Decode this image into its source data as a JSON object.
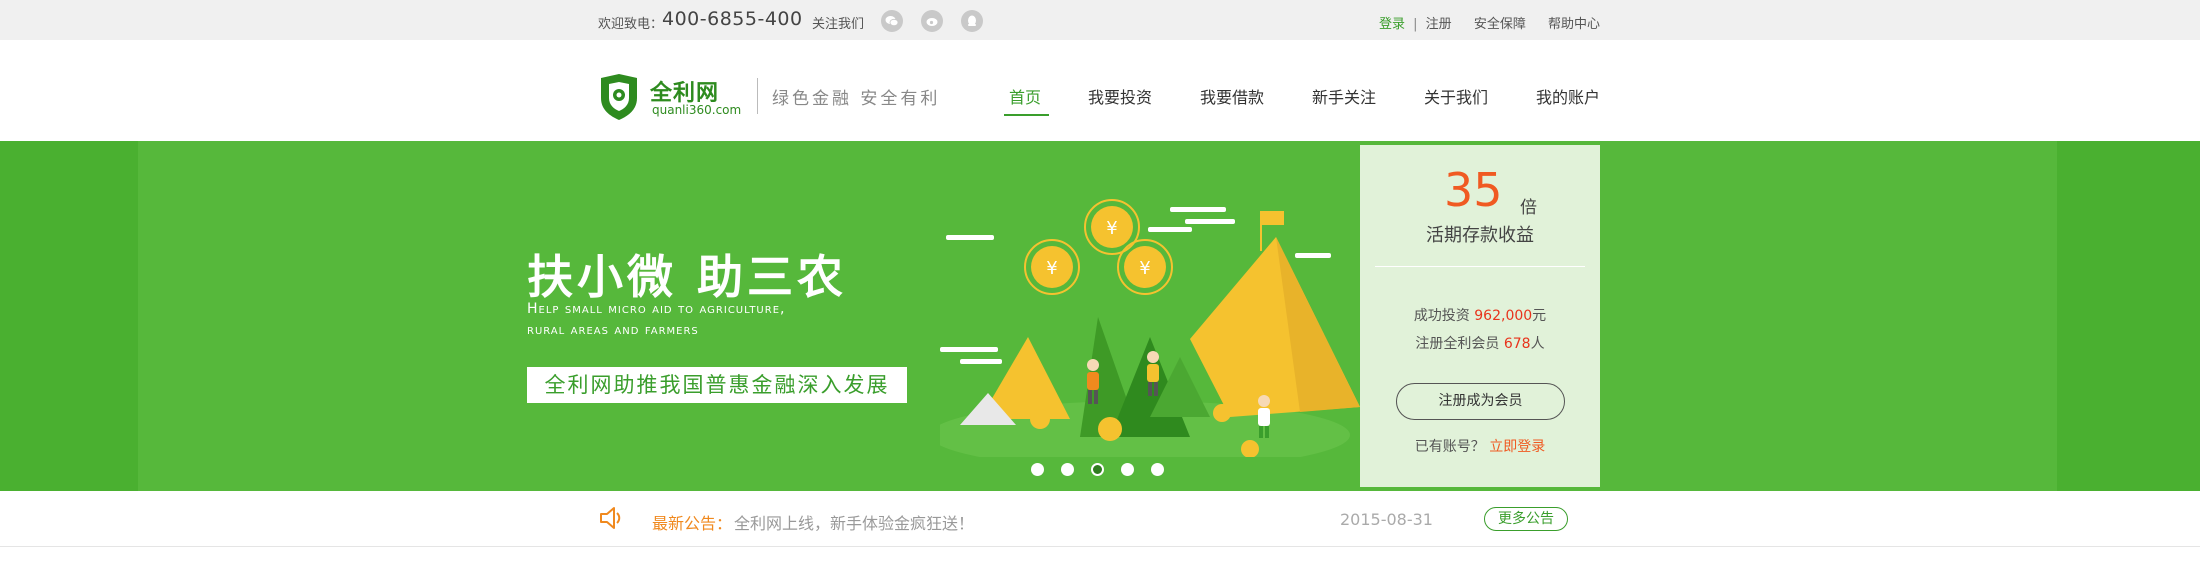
{
  "topbar": {
    "welcome": "欢迎致电：",
    "phone": "400-6855-400",
    "follow": "关注我们",
    "social_icons": [
      "wechat-icon",
      "weibo-icon",
      "qq-icon"
    ],
    "login": "登录",
    "separator": "|",
    "register": "注册",
    "security": "安全保障",
    "help": "帮助中心"
  },
  "header": {
    "logo_cn": "全利网",
    "logo_en": "quanli360.com",
    "slogan": "绿色金融 安全有利",
    "nav": [
      "首页",
      "我要投资",
      "我要借款",
      "新手关注",
      "关于我们",
      "我的账户"
    ],
    "active_nav": "首页"
  },
  "banner": {
    "title": "扶小微  助三农",
    "subtitle_line1": "Help small micro aid to agriculture,",
    "subtitle_line2": "rural areas and farmers",
    "tagline": "全利网助推我国普惠金融深入发展",
    "coin_symbol": "¥",
    "slide_count": 5,
    "active_slide": 3
  },
  "panel": {
    "rate_number": "35",
    "rate_unit": "倍",
    "rate_label": "活期存款收益",
    "invest_label": "成功投资 ",
    "invest_value": "962,000",
    "invest_unit": "元",
    "members_label": "注册全利会员 ",
    "members_value": "678",
    "members_unit": "人",
    "register_button": "注册成为会员",
    "has_account": "已有账号？ ",
    "login_now": "立即登录"
  },
  "notice": {
    "label": "最新公告：",
    "text": "全利网上线，新手体验金疯狂送！",
    "date": "2015-08-31",
    "more": "更多公告"
  },
  "colors": {
    "brand_green": "#3a9e2c",
    "banner_green": "#56b83b",
    "accent_orange": "#f05a22",
    "panel_bg": "#e1f2d9"
  }
}
